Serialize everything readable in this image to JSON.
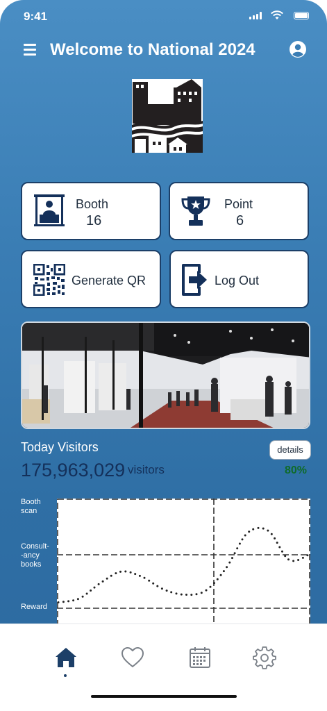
{
  "status_bar": {
    "time": "9:41"
  },
  "header": {
    "title": "Welcome to National 2024"
  },
  "tiles": {
    "booth": {
      "label": "Booth",
      "value": "16"
    },
    "point": {
      "label": "Point",
      "value": "6"
    },
    "generate_qr": {
      "label": "Generate QR"
    },
    "log_out": {
      "label": "Log Out"
    }
  },
  "stats": {
    "title": "Today Visitors",
    "details_label": "details",
    "visitors_count": "175,963,029",
    "visitors_unit": "visitors",
    "percent": "80%"
  },
  "chart_data": {
    "type": "line",
    "y_categories": [
      "Booth scan",
      "Consult--ancy books",
      "Reward"
    ],
    "y_category_lines": [
      {
        "label": "Booth",
        "sub": "scan"
      },
      {
        "label": "Consult-",
        "sub": "-ancy",
        "sub2": "books"
      },
      {
        "label": "Reward"
      }
    ],
    "x": [
      0,
      1,
      2,
      3,
      4,
      5,
      6,
      7,
      8,
      9,
      10,
      11,
      12
    ],
    "values": [
      0.05,
      0.1,
      0.3,
      0.45,
      0.38,
      0.22,
      0.15,
      0.2,
      0.5,
      0.95,
      0.98,
      0.6,
      0.68
    ],
    "ylim": [
      0,
      1.4
    ],
    "grid": true,
    "line_style": "dotted",
    "colors": {
      "series": "#222222",
      "grid": "#333333"
    }
  },
  "tab_bar": {
    "items": [
      {
        "name": "home",
        "icon": "home-icon",
        "active": true
      },
      {
        "name": "favorites",
        "icon": "heart-icon",
        "active": false
      },
      {
        "name": "calendar",
        "icon": "calendar-icon",
        "active": false
      },
      {
        "name": "settings",
        "icon": "gear-icon",
        "active": false
      }
    ]
  },
  "colors": {
    "accent": "#1c3f68",
    "background_top": "#4a8ec4",
    "background_bottom": "#2c69a0",
    "success": "#0f6b2a"
  }
}
